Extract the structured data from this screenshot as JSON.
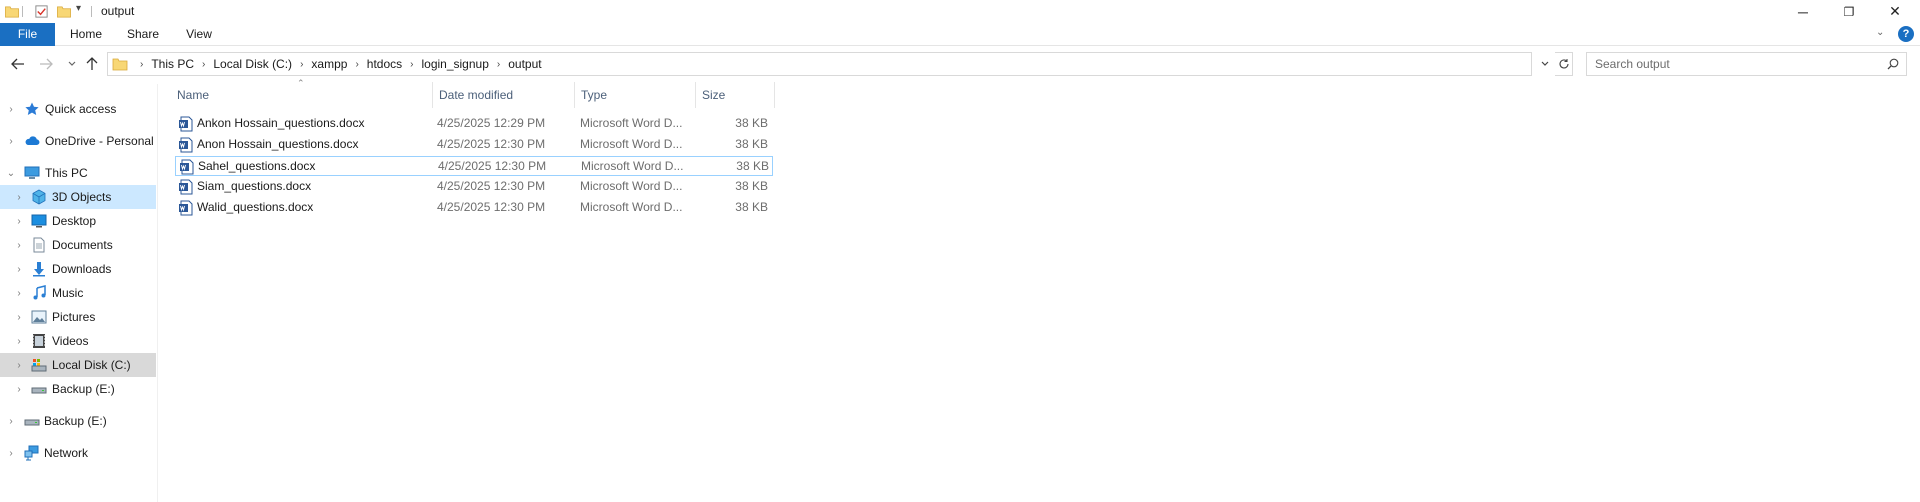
{
  "window": {
    "title": "output",
    "minimize": "─",
    "restore": "❐",
    "close": "✕"
  },
  "ribbon": {
    "tabs": [
      "File",
      "Home",
      "Share",
      "View"
    ]
  },
  "address": {
    "crumbs": [
      "This PC",
      "Local Disk (C:)",
      "xampp",
      "htdocs",
      "login_signup",
      "output"
    ]
  },
  "search": {
    "placeholder": "Search output"
  },
  "nav": {
    "items": [
      {
        "label": "Quick access",
        "icon": "star-icon"
      },
      {
        "label": "OneDrive - Personal",
        "icon": "cloud-icon"
      },
      {
        "label": "This PC",
        "icon": "computer-icon"
      },
      {
        "label": "3D Objects",
        "icon": "cube-icon"
      },
      {
        "label": "Desktop",
        "icon": "desktop-icon"
      },
      {
        "label": "Documents",
        "icon": "document-icon"
      },
      {
        "label": "Downloads",
        "icon": "download-icon"
      },
      {
        "label": "Music",
        "icon": "music-icon"
      },
      {
        "label": "Pictures",
        "icon": "pictures-icon"
      },
      {
        "label": "Videos",
        "icon": "video-icon"
      },
      {
        "label": "Local Disk (C:)",
        "icon": "disk-icon"
      },
      {
        "label": "Backup (E:)",
        "icon": "drive-icon"
      },
      {
        "label": "Backup (E:)",
        "icon": "drive-icon"
      },
      {
        "label": "Network",
        "icon": "network-icon"
      }
    ]
  },
  "list": {
    "columns": [
      "Name",
      "Date modified",
      "Type",
      "Size"
    ],
    "files": [
      {
        "name": "Ankon Hossain_questions.docx",
        "date": "4/25/2025 12:29 PM",
        "type": "Microsoft Word D...",
        "size": "38 KB"
      },
      {
        "name": "Anon Hossain_questions.docx",
        "date": "4/25/2025 12:30 PM",
        "type": "Microsoft Word D...",
        "size": "38 KB"
      },
      {
        "name": "Sahel_questions.docx",
        "date": "4/25/2025 12:30 PM",
        "type": "Microsoft Word D...",
        "size": "38 KB"
      },
      {
        "name": "Siam_questions.docx",
        "date": "4/25/2025 12:30 PM",
        "type": "Microsoft Word D...",
        "size": "38 KB"
      },
      {
        "name": "Walid_questions.docx",
        "date": "4/25/2025 12:30 PM",
        "type": "Microsoft Word D...",
        "size": "38 KB"
      }
    ]
  },
  "colors": {
    "accent": "#1a6fc2",
    "selection": "#cce8ff",
    "hover": "#d9d9d9",
    "folder": "#f8d775"
  }
}
